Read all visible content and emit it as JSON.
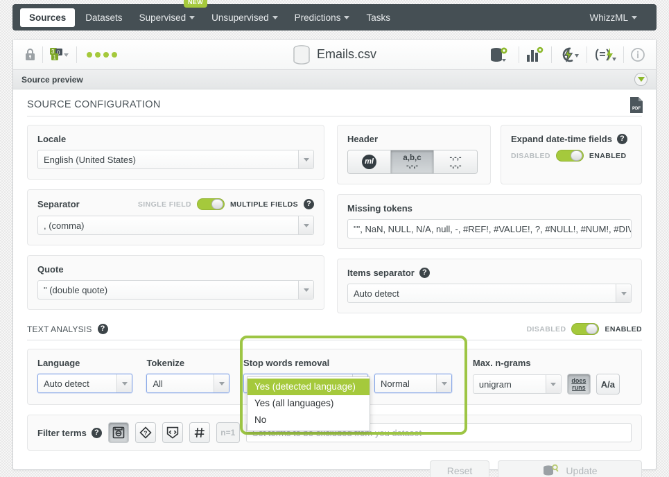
{
  "nav": {
    "items": [
      {
        "label": "Sources",
        "active": true,
        "caret": false
      },
      {
        "label": "Datasets",
        "active": false,
        "caret": false
      },
      {
        "label": "Supervised",
        "active": false,
        "caret": true
      },
      {
        "label": "Unsupervised",
        "active": false,
        "caret": true
      },
      {
        "label": "Predictions",
        "active": false,
        "caret": true
      },
      {
        "label": "Tasks",
        "active": false,
        "caret": false
      }
    ],
    "badge": "NEW",
    "right_label": "WhizzML"
  },
  "source_header": {
    "title": "Emails.csv",
    "lock_icon": "lock-icon",
    "fields_icon": "field-types-icon",
    "status_dots": 4,
    "right_icons": [
      "dataset-settings-icon",
      "chart-settings-icon",
      "batch-prediction-icon",
      "script-icon",
      "info-icon"
    ]
  },
  "preview_bar": {
    "label": "Source preview",
    "collapse_icon": "chevron-down-circle-icon"
  },
  "source_config": {
    "title": "SOURCE CONFIGURATION",
    "pdf_icon_label": "PDF",
    "locale": {
      "label": "Locale",
      "value": "English (United States)"
    },
    "separator": {
      "label": "Separator",
      "value": ", (comma)",
      "toggle_off_label": "SINGLE FIELD",
      "toggle_on_label": "MULTIPLE FIELDS",
      "enabled": true
    },
    "quote": {
      "label": "Quote",
      "value": "\" (double quote)"
    },
    "header": {
      "label": "Header",
      "options": [
        {
          "name": "ml-logo-option",
          "top": "ml",
          "bottom": "",
          "selected": false
        },
        {
          "name": "abc-header-option",
          "top": "a,b,c",
          "bottom": "-,-,-",
          "selected": true
        },
        {
          "name": "no-header-option",
          "top": "-,-,-",
          "bottom": "-,-,-",
          "selected": false
        }
      ]
    },
    "expand_datetime": {
      "label": "Expand date-time fields",
      "toggle_off_label": "DISABLED",
      "toggle_on_label": "ENABLED",
      "enabled": true
    },
    "missing_tokens": {
      "label": "Missing tokens",
      "value": "\"\", NaN, NULL, N/A, null, -, #REF!, #VALUE!, ?, #NULL!, #NUM!, #DIV"
    },
    "items_separator": {
      "label": "Items separator",
      "value": "Auto detect"
    }
  },
  "text_analysis": {
    "title": "TEXT ANALYSIS",
    "toggle_off_label": "DISABLED",
    "toggle_on_label": "ENABLED",
    "enabled": true,
    "language": {
      "label": "Language",
      "value": "Auto detect"
    },
    "tokenize": {
      "label": "Tokenize",
      "value": "All"
    },
    "stop_words": {
      "label": "Stop words removal",
      "value": "Yes (detected language)",
      "strength_value": "Normal",
      "options": [
        "Yes (detected language)",
        "Yes (all languages)",
        "No"
      ],
      "selected_index": 0
    },
    "max_ngrams": {
      "label": "Max. n-grams",
      "value": "unigram",
      "stemming_button": {
        "line1": "does",
        "line2": "runs",
        "active": true
      },
      "case_button": {
        "label": "A/a",
        "active": false
      }
    },
    "filter_terms": {
      "label": "Filter terms",
      "buttons": [
        {
          "name": "exclude-terms-icon",
          "active": true
        },
        {
          "name": "unknown-terms-icon",
          "active": false
        },
        {
          "name": "code-terms-icon",
          "active": false
        },
        {
          "name": "numeric-terms-icon",
          "active": false
        }
      ],
      "ngram_button": "n=1",
      "input_placeholder": "Set terms to be excluded from you dataset"
    }
  },
  "footer": {
    "reset_label": "Reset",
    "update_label": "Update",
    "update_icon": "dataset-search-icon"
  },
  "colors": {
    "accent_green": "#a5c93c",
    "navbar": "#454f54",
    "highlight": "#9dc544"
  }
}
